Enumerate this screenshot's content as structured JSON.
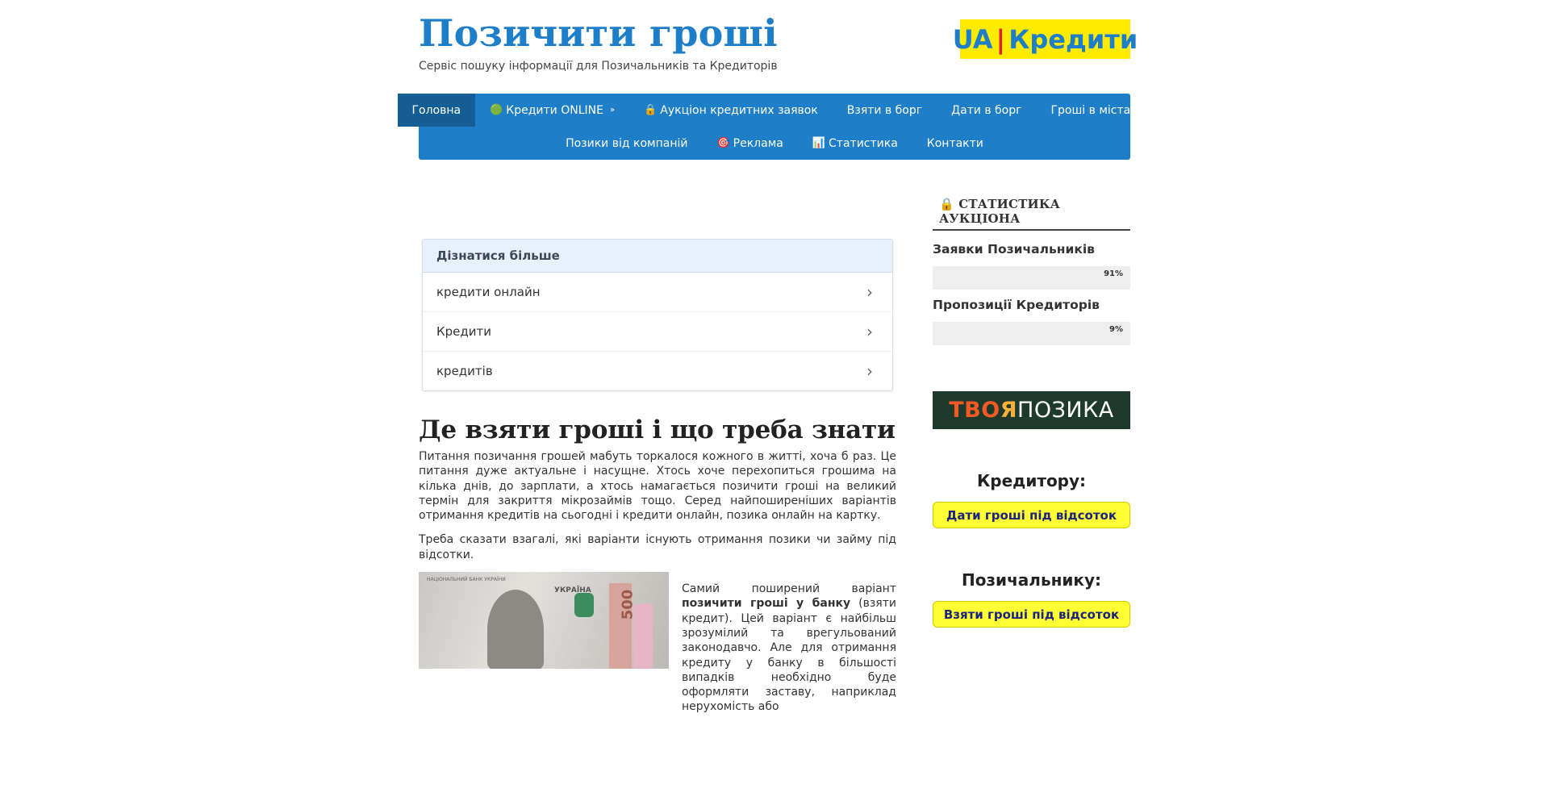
{
  "header": {
    "title": "Позичити гроші",
    "description": "Сервіс пошуку інформації для Позичальників та Кредиторів",
    "logo": {
      "left": "UA",
      "right": "Кредити"
    }
  },
  "nav": {
    "row1": [
      {
        "label": "Головна",
        "icon": "",
        "active": true
      },
      {
        "label": "Кредити ONLINE",
        "icon": "🟢",
        "dropdown": "»"
      },
      {
        "label": "Аукціон кредитних заявок",
        "icon": "🔒"
      },
      {
        "label": "Взяти в борг",
        "icon": ""
      },
      {
        "label": "Дати в борг",
        "icon": ""
      },
      {
        "label": "Гроші в містах",
        "icon": ""
      }
    ],
    "row2": [
      {
        "label": "Позики від компаній",
        "icon": ""
      },
      {
        "label": "Реклама",
        "icon": "🎯"
      },
      {
        "label": "Статистика",
        "icon": "📊"
      },
      {
        "label": "Контакти",
        "icon": ""
      }
    ]
  },
  "learn_more": {
    "title": "Дізнатися більше",
    "items": [
      "кредити онлайн",
      "Кредити",
      "кредитів"
    ],
    "arrow": "›"
  },
  "article": {
    "title": "Де взяти гроші і що треба знати",
    "para1": "Питання позичання грошей мабуть торкалося кожного в житті, хоча б раз. Це питання дуже актуальне і насущне. Хтось хоче перехопиться грошима на кілька днів, до зарплати, а хтось намагається позичити гроші на великий термін для закриття мікрозаймів тощо. Серед найпоширеніших варіантів отримання кредитів на сьогодні і кредити онлайн, позика онлайн на картку.",
    "para2": "Треба сказати взагалі, які варіанти існують отримання позики чи займу під відсотки.",
    "side_text_1": "Самий поширений варіант ",
    "side_text_bold": "позичити гроші у банку",
    "side_text_2": " (взяти кредит). Цей варіант є найбільш зрозумілий та врегульований законодавчо. Але для отримання кредиту у банку в більшості випадків необхідно буде оформляти заставу, наприклад нерухомість або",
    "banknote": {
      "header": "НАЦІОНАЛЬНИЙ БАНК УКРАЇНИ",
      "country": "УКРАЇНА",
      "denomination": "500"
    }
  },
  "sidebar": {
    "stats_title": "🔒 Статистика аукціона",
    "borrowers_label": "Заявки Позичальників",
    "borrowers_pct": "91%",
    "borrowers_value": 91,
    "lenders_label": "Пропозиції Кредиторів",
    "lenders_pct": "9%",
    "lenders_value": 9,
    "ad": {
      "a": "ТВО",
      "b": "Я",
      "c": "ПОЗИКА"
    },
    "lender_title": "Кредитору:",
    "lender_button": "Дати гроші під відсоток",
    "borrower_title": "Позичальнику:",
    "borrower_button": "Взяти гроші під відсоток"
  },
  "colors": {
    "brand_blue": "#1e7ec8",
    "nav_active": "#155d95",
    "logo_yellow": "#ffeb00",
    "cta_yellow": "#ffff33"
  }
}
